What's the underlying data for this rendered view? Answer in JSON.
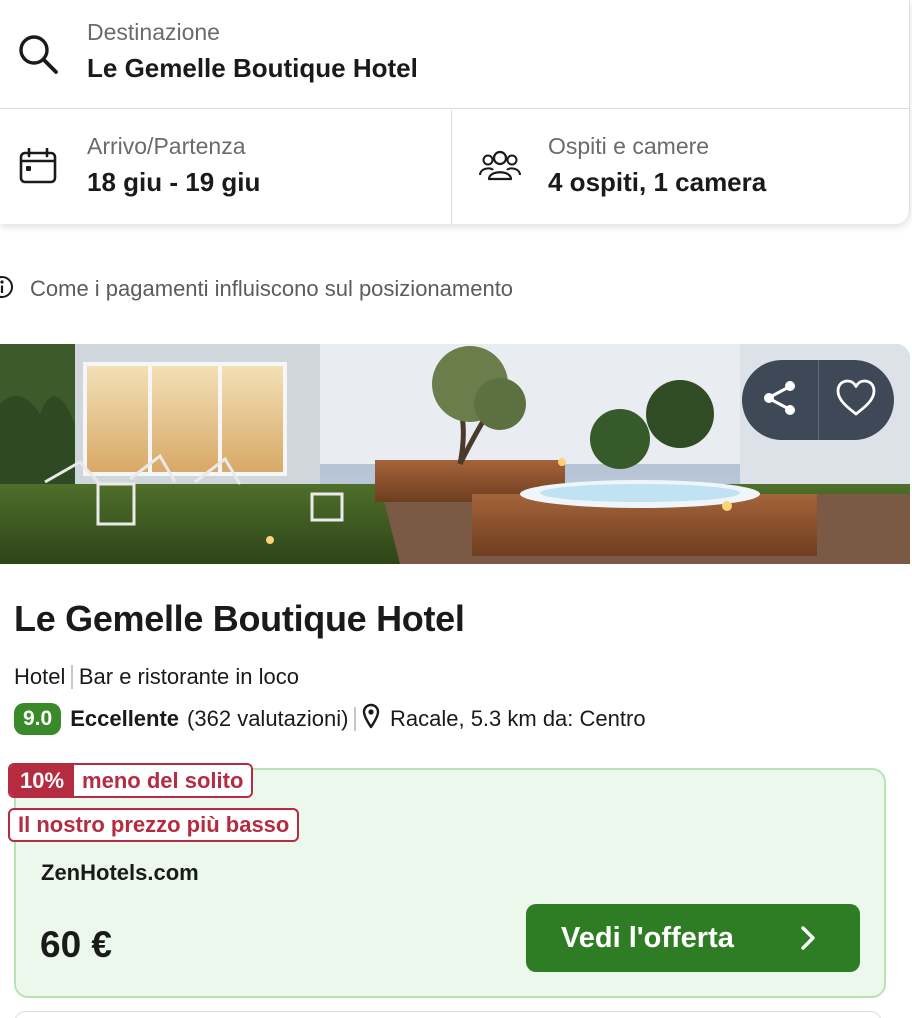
{
  "search": {
    "destination": {
      "label": "Destinazione",
      "value": "Le Gemelle Boutique Hotel",
      "icon": "search-icon"
    },
    "dates": {
      "label": "Arrivo/Partenza",
      "value": "18 giu - 19 giu",
      "icon": "calendar-icon"
    },
    "guests": {
      "label": "Ospiti e camere",
      "value": "4 ospiti, 1 camera",
      "icon": "guests-icon"
    }
  },
  "ranking_info": {
    "text": "Come i pagamenti influiscono sul posizionamento",
    "icon": "info-icon"
  },
  "hotel": {
    "name": "Le Gemelle Boutique Hotel",
    "type": "Hotel",
    "amenity": "Bar e ristorante in loco",
    "score": "9.0",
    "score_word": "Eccellente",
    "reviews": "(362 valutazioni)",
    "location": "Racale, 5.3 km da: Centro",
    "photo_actions": {
      "share_icon": "share-icon",
      "favorite_icon": "heart-icon"
    }
  },
  "deal": {
    "discount_pct": "10%",
    "discount_label": "meno del solito",
    "lowest_price_label": "Il nostro prezzo più basso",
    "provider": "ZenHotels.com",
    "price": "60 €",
    "cta_label": "Vedi l'offerta"
  },
  "colors": {
    "score_green": "#3a8a2a",
    "cta_green": "#2e7d24",
    "deal_bg": "#ecf8ec",
    "deal_border": "#b6e3b4",
    "badge_red": "#b52b40"
  }
}
